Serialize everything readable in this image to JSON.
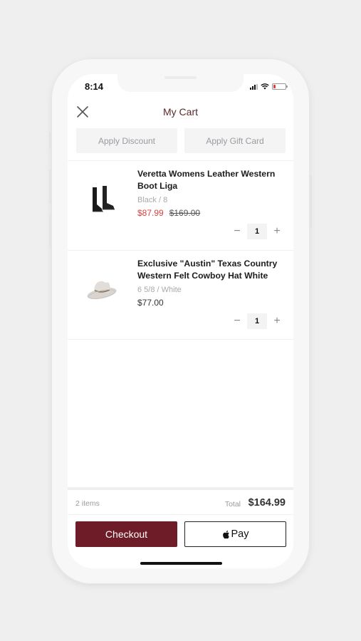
{
  "status_bar": {
    "time": "8:14"
  },
  "header": {
    "title": "My Cart"
  },
  "actions": {
    "apply_discount": "Apply Discount",
    "apply_gift_card": "Apply Gift Card"
  },
  "items": [
    {
      "name": "Veretta Womens Leather Western Boot Liga",
      "variant": "Black / 8",
      "sale_price": "$87.99",
      "original_price": "$169.00",
      "quantity": "1",
      "thumbnail_icon": "boots-icon"
    },
    {
      "name": "Exclusive \"Austin\" Texas Country Western Felt Cowboy Hat White",
      "variant": "6 5/8 / White",
      "price": "$77.00",
      "quantity": "1",
      "thumbnail_icon": "cowboy-hat-icon"
    }
  ],
  "qty_controls": {
    "decrease": "−",
    "increase": "+"
  },
  "footer": {
    "item_count": "2 items",
    "total_label": "Total",
    "total_value": "$164.99",
    "checkout_label": "Checkout",
    "applepay_label": "Pay"
  },
  "colors": {
    "checkout": "#6e1c27",
    "sale_price": "#d6453f",
    "title": "#5a2a2a"
  }
}
